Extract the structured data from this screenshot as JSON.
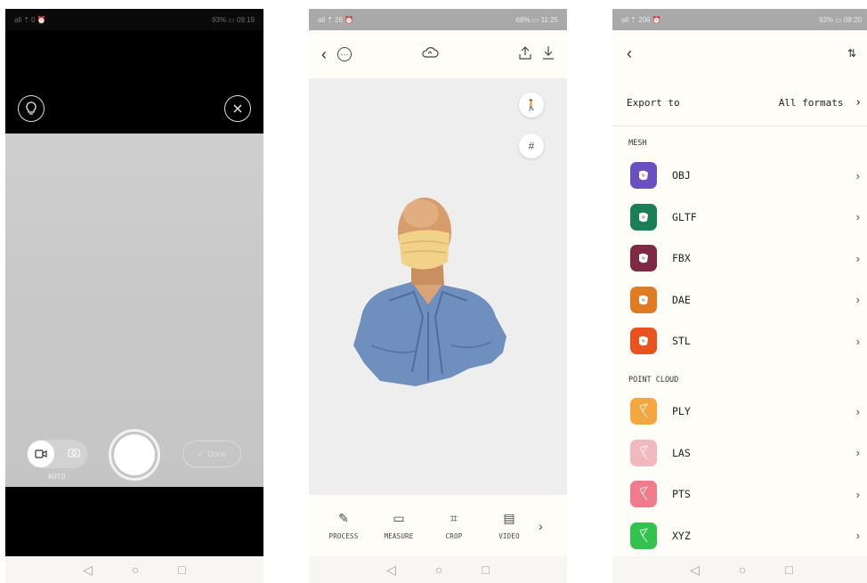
{
  "screens": {
    "capture": {
      "status": {
        "left": "all ⇡ 0 ⏰",
        "right": "93% ▭ 09:19"
      },
      "icons": {
        "flash": "lightbulb-icon",
        "close": "close-icon",
        "video": "video-camera-icon",
        "photo": "camera-icon",
        "done": "check-icon"
      },
      "mode_label": "AUTO",
      "done_label": "Done"
    },
    "viewer": {
      "status": {
        "left": "all ⇡ 26 ⏰",
        "right": "68% ▭ 11:25"
      },
      "header_icons": {
        "back": "‹",
        "more": "⋯",
        "cloud": "☁",
        "share": "⇧",
        "download": "⇩"
      },
      "tools": [
        {
          "icon": "✎",
          "label": "PROCESS"
        },
        {
          "icon": "▭",
          "label": "MEASURE"
        },
        {
          "icon": "⌗",
          "label": "CROP"
        },
        {
          "icon": "▤",
          "label": "VIDEO"
        }
      ]
    },
    "export": {
      "status": {
        "left": "all ⇡ 206 ⏰",
        "right": "93% ▭ 09:20"
      },
      "export_to_label": "Export to",
      "export_to_value": "All formats",
      "mesh_heading": "MESH",
      "mesh_formats": [
        {
          "name": "OBJ",
          "color": "#6a4fc0"
        },
        {
          "name": "GLTF",
          "color": "#1a7f56"
        },
        {
          "name": "FBX",
          "color": "#7f2a45"
        },
        {
          "name": "DAE",
          "color": "#e07b22"
        },
        {
          "name": "STL",
          "color": "#e8541f"
        }
      ],
      "point_cloud_heading": "POINT CLOUD",
      "point_formats": [
        {
          "name": "PLY",
          "color": "#f4a640"
        },
        {
          "name": "LAS",
          "color": "#f2b8bf"
        },
        {
          "name": "PTS",
          "color": "#f07b8b"
        },
        {
          "name": "XYZ",
          "color": "#32c24d"
        }
      ]
    }
  }
}
